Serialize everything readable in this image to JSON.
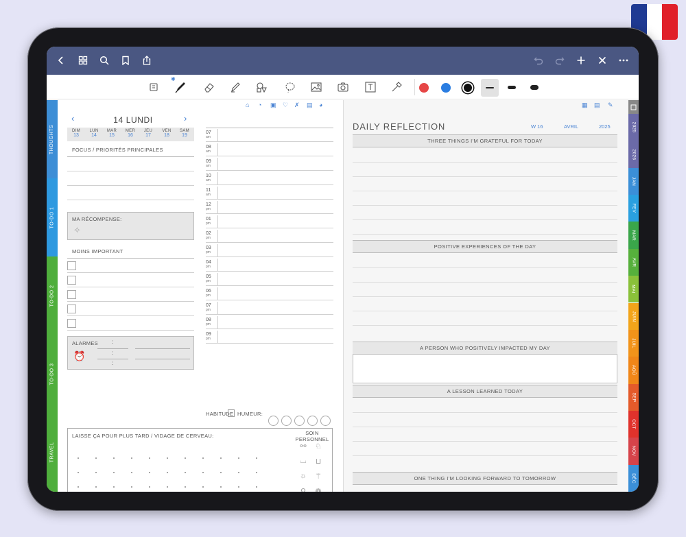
{
  "colors": {
    "accent": "#4a84d4",
    "topbar": "#4a5782",
    "tab_gray": "#888888"
  },
  "left_tabs": [
    {
      "label": "THOUGHTS",
      "color": "#3d8ed6"
    },
    {
      "label": "TO-DO 1",
      "color": "#2e99e0"
    },
    {
      "label": "TO-DO 2",
      "color": "#4fae3c"
    },
    {
      "label": "TO-DO 3",
      "color": "#4fae3c"
    },
    {
      "label": "TRAVEL",
      "color": "#4fae3c"
    }
  ],
  "right_tabs": [
    {
      "label": "2025",
      "color": "#6b6aa8"
    },
    {
      "label": "2026",
      "color": "#6b6aa8"
    },
    {
      "label": "JAN",
      "color": "#3b8fd8"
    },
    {
      "label": "FEV",
      "color": "#2aa0e0"
    },
    {
      "label": "MAR",
      "color": "#3aa64a"
    },
    {
      "label": "AVR",
      "color": "#56b03c"
    },
    {
      "label": "MAI",
      "color": "#8ac13a"
    },
    {
      "label": "JUIN",
      "color": "#f2a41a"
    },
    {
      "label": "JUIL",
      "color": "#f2931a"
    },
    {
      "label": "AOÛ",
      "color": "#f08618"
    },
    {
      "label": "SEP",
      "color": "#e45a2a"
    },
    {
      "label": "OCT",
      "color": "#e0322c"
    },
    {
      "label": "NOV",
      "color": "#d6434a"
    },
    {
      "label": "DÉC",
      "color": "#3b8fd8"
    }
  ],
  "left": {
    "date": "14 LUNDI",
    "days": [
      {
        "name": "DIM",
        "num": "13"
      },
      {
        "name": "LUN",
        "num": "14"
      },
      {
        "name": "MAR",
        "num": "15"
      },
      {
        "name": "MER",
        "num": "16"
      },
      {
        "name": "JEU",
        "num": "17"
      },
      {
        "name": "VEN",
        "num": "18"
      },
      {
        "name": "SAM",
        "num": "19"
      }
    ],
    "focus": "FOCUS / PRIORITÉS PRINCIPALES",
    "reward": "MA RÉCOMPENSE:",
    "less": "MOINS IMPORTANT",
    "alarms": "ALARMES",
    "colon": ":",
    "braindump": "LAISSE ÇA POUR PLUS TARD / VIDAGE DE CERVEAU:",
    "selfcare": "SOIN PERSONNEL",
    "habit": "HABITUDE",
    "mood": "HUMEUR:",
    "hours": [
      {
        "h": "07",
        "p": "am"
      },
      {
        "h": "08",
        "p": "am"
      },
      {
        "h": "09",
        "p": "am"
      },
      {
        "h": "10",
        "p": "am"
      },
      {
        "h": "11",
        "p": "am"
      },
      {
        "h": "12",
        "p": "pm"
      },
      {
        "h": "01",
        "p": "pm"
      },
      {
        "h": "02",
        "p": "pm"
      },
      {
        "h": "03",
        "p": "pm"
      },
      {
        "h": "04",
        "p": "pm"
      },
      {
        "h": "05",
        "p": "pm"
      },
      {
        "h": "06",
        "p": "pm"
      },
      {
        "h": "07",
        "p": "pm"
      },
      {
        "h": "08",
        "p": "pm"
      },
      {
        "h": "09",
        "p": "pm"
      }
    ]
  },
  "right": {
    "title": "DAILY REFLECTION",
    "week": "W 16",
    "month": "AVRIL",
    "year": "2025",
    "sections": [
      "THREE THINGS I'M GRATEFUL FOR TODAY",
      "POSITIVE EXPERIENCES OF THE DAY",
      "A PERSON WHO POSITIVELY IMPACTED MY DAY",
      "A LESSON LEARNED TODAY",
      "ONE THING I'M LOOKING FORWARD TO TOMORROW"
    ]
  }
}
